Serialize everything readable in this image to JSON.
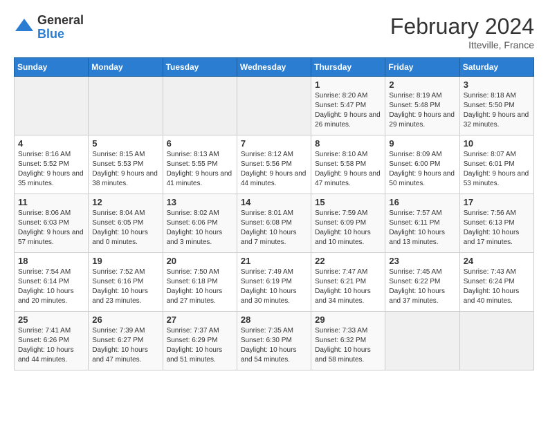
{
  "header": {
    "logo_general": "General",
    "logo_blue": "Blue",
    "month_title": "February 2024",
    "location": "Itteville, France"
  },
  "calendar": {
    "weekdays": [
      "Sunday",
      "Monday",
      "Tuesday",
      "Wednesday",
      "Thursday",
      "Friday",
      "Saturday"
    ],
    "weeks": [
      [
        {
          "day": "",
          "sunrise": "",
          "sunset": "",
          "daylight": ""
        },
        {
          "day": "",
          "sunrise": "",
          "sunset": "",
          "daylight": ""
        },
        {
          "day": "",
          "sunrise": "",
          "sunset": "",
          "daylight": ""
        },
        {
          "day": "",
          "sunrise": "",
          "sunset": "",
          "daylight": ""
        },
        {
          "day": "1",
          "sunrise": "Sunrise: 8:20 AM",
          "sunset": "Sunset: 5:47 PM",
          "daylight": "Daylight: 9 hours and 26 minutes."
        },
        {
          "day": "2",
          "sunrise": "Sunrise: 8:19 AM",
          "sunset": "Sunset: 5:48 PM",
          "daylight": "Daylight: 9 hours and 29 minutes."
        },
        {
          "day": "3",
          "sunrise": "Sunrise: 8:18 AM",
          "sunset": "Sunset: 5:50 PM",
          "daylight": "Daylight: 9 hours and 32 minutes."
        }
      ],
      [
        {
          "day": "4",
          "sunrise": "Sunrise: 8:16 AM",
          "sunset": "Sunset: 5:52 PM",
          "daylight": "Daylight: 9 hours and 35 minutes."
        },
        {
          "day": "5",
          "sunrise": "Sunrise: 8:15 AM",
          "sunset": "Sunset: 5:53 PM",
          "daylight": "Daylight: 9 hours and 38 minutes."
        },
        {
          "day": "6",
          "sunrise": "Sunrise: 8:13 AM",
          "sunset": "Sunset: 5:55 PM",
          "daylight": "Daylight: 9 hours and 41 minutes."
        },
        {
          "day": "7",
          "sunrise": "Sunrise: 8:12 AM",
          "sunset": "Sunset: 5:56 PM",
          "daylight": "Daylight: 9 hours and 44 minutes."
        },
        {
          "day": "8",
          "sunrise": "Sunrise: 8:10 AM",
          "sunset": "Sunset: 5:58 PM",
          "daylight": "Daylight: 9 hours and 47 minutes."
        },
        {
          "day": "9",
          "sunrise": "Sunrise: 8:09 AM",
          "sunset": "Sunset: 6:00 PM",
          "daylight": "Daylight: 9 hours and 50 minutes."
        },
        {
          "day": "10",
          "sunrise": "Sunrise: 8:07 AM",
          "sunset": "Sunset: 6:01 PM",
          "daylight": "Daylight: 9 hours and 53 minutes."
        }
      ],
      [
        {
          "day": "11",
          "sunrise": "Sunrise: 8:06 AM",
          "sunset": "Sunset: 6:03 PM",
          "daylight": "Daylight: 9 hours and 57 minutes."
        },
        {
          "day": "12",
          "sunrise": "Sunrise: 8:04 AM",
          "sunset": "Sunset: 6:05 PM",
          "daylight": "Daylight: 10 hours and 0 minutes."
        },
        {
          "day": "13",
          "sunrise": "Sunrise: 8:02 AM",
          "sunset": "Sunset: 6:06 PM",
          "daylight": "Daylight: 10 hours and 3 minutes."
        },
        {
          "day": "14",
          "sunrise": "Sunrise: 8:01 AM",
          "sunset": "Sunset: 6:08 PM",
          "daylight": "Daylight: 10 hours and 7 minutes."
        },
        {
          "day": "15",
          "sunrise": "Sunrise: 7:59 AM",
          "sunset": "Sunset: 6:09 PM",
          "daylight": "Daylight: 10 hours and 10 minutes."
        },
        {
          "day": "16",
          "sunrise": "Sunrise: 7:57 AM",
          "sunset": "Sunset: 6:11 PM",
          "daylight": "Daylight: 10 hours and 13 minutes."
        },
        {
          "day": "17",
          "sunrise": "Sunrise: 7:56 AM",
          "sunset": "Sunset: 6:13 PM",
          "daylight": "Daylight: 10 hours and 17 minutes."
        }
      ],
      [
        {
          "day": "18",
          "sunrise": "Sunrise: 7:54 AM",
          "sunset": "Sunset: 6:14 PM",
          "daylight": "Daylight: 10 hours and 20 minutes."
        },
        {
          "day": "19",
          "sunrise": "Sunrise: 7:52 AM",
          "sunset": "Sunset: 6:16 PM",
          "daylight": "Daylight: 10 hours and 23 minutes."
        },
        {
          "day": "20",
          "sunrise": "Sunrise: 7:50 AM",
          "sunset": "Sunset: 6:18 PM",
          "daylight": "Daylight: 10 hours and 27 minutes."
        },
        {
          "day": "21",
          "sunrise": "Sunrise: 7:49 AM",
          "sunset": "Sunset: 6:19 PM",
          "daylight": "Daylight: 10 hours and 30 minutes."
        },
        {
          "day": "22",
          "sunrise": "Sunrise: 7:47 AM",
          "sunset": "Sunset: 6:21 PM",
          "daylight": "Daylight: 10 hours and 34 minutes."
        },
        {
          "day": "23",
          "sunrise": "Sunrise: 7:45 AM",
          "sunset": "Sunset: 6:22 PM",
          "daylight": "Daylight: 10 hours and 37 minutes."
        },
        {
          "day": "24",
          "sunrise": "Sunrise: 7:43 AM",
          "sunset": "Sunset: 6:24 PM",
          "daylight": "Daylight: 10 hours and 40 minutes."
        }
      ],
      [
        {
          "day": "25",
          "sunrise": "Sunrise: 7:41 AM",
          "sunset": "Sunset: 6:26 PM",
          "daylight": "Daylight: 10 hours and 44 minutes."
        },
        {
          "day": "26",
          "sunrise": "Sunrise: 7:39 AM",
          "sunset": "Sunset: 6:27 PM",
          "daylight": "Daylight: 10 hours and 47 minutes."
        },
        {
          "day": "27",
          "sunrise": "Sunrise: 7:37 AM",
          "sunset": "Sunset: 6:29 PM",
          "daylight": "Daylight: 10 hours and 51 minutes."
        },
        {
          "day": "28",
          "sunrise": "Sunrise: 7:35 AM",
          "sunset": "Sunset: 6:30 PM",
          "daylight": "Daylight: 10 hours and 54 minutes."
        },
        {
          "day": "29",
          "sunrise": "Sunrise: 7:33 AM",
          "sunset": "Sunset: 6:32 PM",
          "daylight": "Daylight: 10 hours and 58 minutes."
        },
        {
          "day": "",
          "sunrise": "",
          "sunset": "",
          "daylight": ""
        },
        {
          "day": "",
          "sunrise": "",
          "sunset": "",
          "daylight": ""
        }
      ]
    ]
  }
}
